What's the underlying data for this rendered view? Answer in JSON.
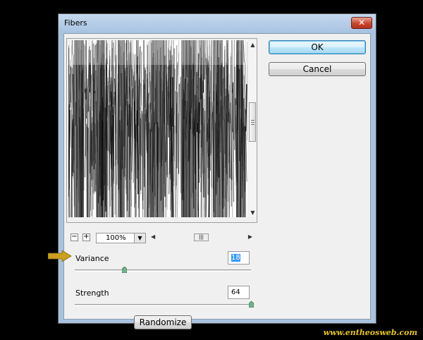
{
  "dialog": {
    "title": "Fibers",
    "close_icon": "close-icon"
  },
  "buttons": {
    "ok": "OK",
    "cancel": "Cancel",
    "randomize": "Randomize"
  },
  "preview": {
    "zoom_out": "−",
    "zoom_in": "+",
    "zoom_value": "100%",
    "hscroll_grip": "|||"
  },
  "variance": {
    "label": "Variance",
    "value": "18",
    "max": 64
  },
  "strength": {
    "label": "Strength",
    "value": "64",
    "max": 64
  },
  "colors": {
    "pointer_arrow": "#c9a11e",
    "watermark": "#e8c418"
  },
  "watermark": "www.entheosweb.com"
}
